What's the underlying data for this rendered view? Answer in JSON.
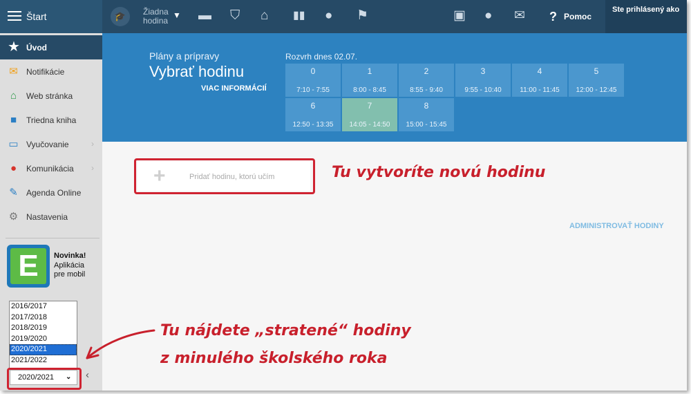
{
  "topbar": {
    "brand_title": "Štart",
    "lesson_line1": "Žiadna",
    "lesson_line2": "hodina",
    "help_label": "Pomoc",
    "login_text": "Ste prihlásený ako"
  },
  "sidebar": {
    "items": [
      {
        "label": "Úvod",
        "icon": "star-icon"
      },
      {
        "label": "Notifikácie",
        "icon": "envelope-icon"
      },
      {
        "label": "Web stránka",
        "icon": "home-icon"
      },
      {
        "label": "Triedna kniha",
        "icon": "book-icon"
      },
      {
        "label": "Vyučovanie",
        "icon": "open-book-icon"
      },
      {
        "label": "Komunikácia",
        "icon": "chat-icon"
      },
      {
        "label": "Agenda Online",
        "icon": "pen-icon"
      },
      {
        "label": "Nastavenia",
        "icon": "gear-icon"
      }
    ],
    "promo": {
      "logo_letter": "E",
      "title": "Novinka!",
      "line1": "Aplikácia",
      "line2": "pre mobil"
    },
    "years": [
      "2016/2017",
      "2017/2018",
      "2018/2019",
      "2019/2020",
      "2020/2021",
      "2021/2022"
    ],
    "selected_year": "2020/2021"
  },
  "header": {
    "subtitle": "Plány a prípravy",
    "title": "Vybrať hodinu",
    "more_info": "VIAC INFORMÁCIÍ",
    "schedule_title": "Rozvrh dnes 02.07.",
    "slots": [
      {
        "num": "0",
        "time": "7:10 - 7:55"
      },
      {
        "num": "1",
        "time": "8:00 - 8:45"
      },
      {
        "num": "2",
        "time": "8:55 - 9:40"
      },
      {
        "num": "3",
        "time": "9:55 - 10:40"
      },
      {
        "num": "4",
        "time": "11:00 - 11:45"
      },
      {
        "num": "5",
        "time": "12:00 - 12:45"
      },
      {
        "num": "6",
        "time": "12:50 - 13:35"
      },
      {
        "num": "7",
        "time": "14:05 - 14:50"
      },
      {
        "num": "8",
        "time": "15:00 - 15:45"
      }
    ],
    "active_slot": "7"
  },
  "content": {
    "add_placeholder": "Pridať hodinu, ktorú učím",
    "admin_link": "ADMINISTROVAŤ HODINY"
  },
  "annotations": {
    "create_lesson": "Tu vytvoríte novú hodinu",
    "lost_lessons_line1": "Tu nájdete „stratené“ hodiny",
    "lost_lessons_line2": "z minulého školského roka"
  },
  "colors": {
    "topbar": "#264a66",
    "header": "#2d82c0",
    "slot": "#4b97ce",
    "slot_active": "#82bfae",
    "annotation": "#cf2331"
  }
}
